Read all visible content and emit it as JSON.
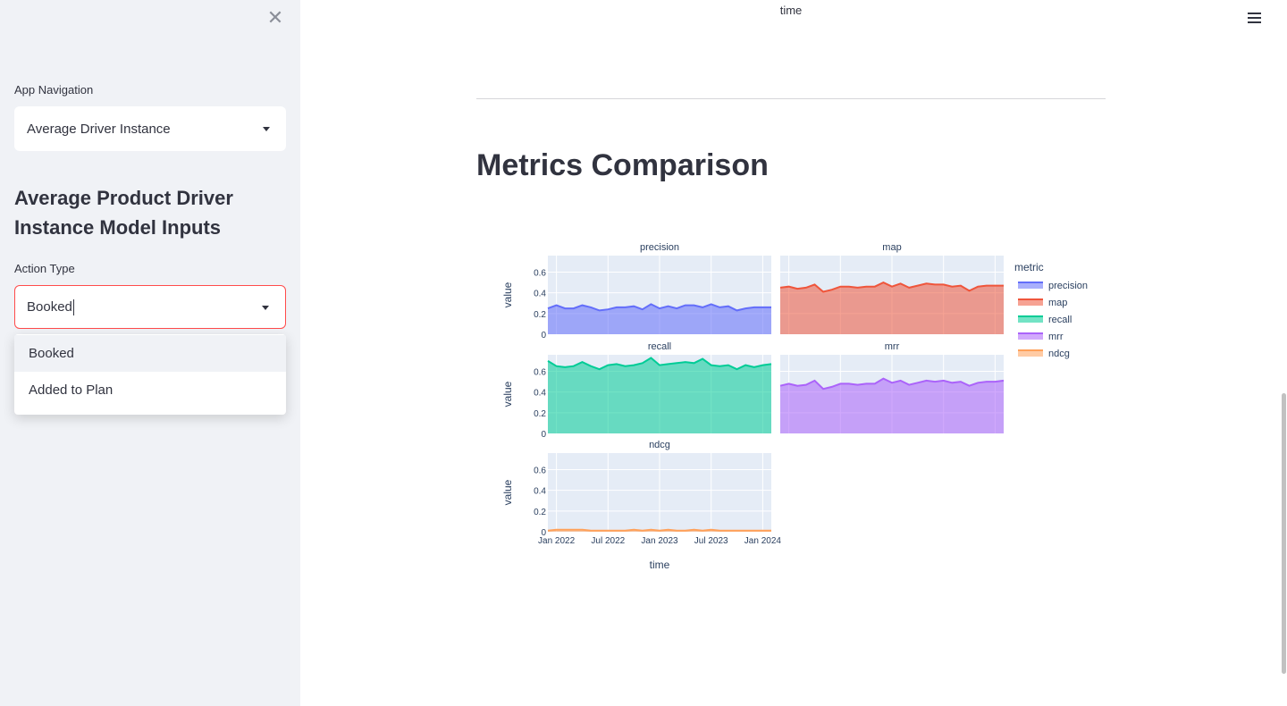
{
  "sidebar": {
    "nav_label": "App Navigation",
    "nav_value": "Average Driver Instance",
    "heading": "Average Product Driver Instance Model Inputs",
    "action_label": "Action Type",
    "action_value": "Booked",
    "dropdown_options": [
      "Booked",
      "Added to Plan"
    ]
  },
  "main": {
    "top_axis_label": "time",
    "title": "Metrics Comparison"
  },
  "colors": {
    "accent_red": "#ff4b4b",
    "precision": "#636efa",
    "map": "#ef553b",
    "recall": "#00cc96",
    "mrr": "#ab63fa",
    "ndcg": "#ffa15a"
  },
  "chart_data": {
    "type": "area",
    "facets": [
      "precision",
      "map",
      "recall",
      "mrr",
      "ndcg"
    ],
    "x": [
      "2021-12",
      "2022-01",
      "2022-02",
      "2022-03",
      "2022-04",
      "2022-05",
      "2022-06",
      "2022-07",
      "2022-08",
      "2022-09",
      "2022-10",
      "2022-11",
      "2022-12",
      "2023-01",
      "2023-02",
      "2023-03",
      "2023-04",
      "2023-05",
      "2023-06",
      "2023-07",
      "2023-08",
      "2023-09",
      "2023-10",
      "2023-11",
      "2023-12",
      "2024-01",
      "2024-02"
    ],
    "xticks": [
      "Jan 2022",
      "Jul 2022",
      "Jan 2023",
      "Jul 2023",
      "Jan 2024"
    ],
    "xlabel": "time",
    "ylabel": "value",
    "yticks": [
      "0",
      "0.2",
      "0.4",
      "0.6"
    ],
    "ylim": [
      0,
      0.76
    ],
    "legend_title": "metric",
    "legend_position": "right",
    "series": [
      {
        "name": "precision",
        "values": [
          0.25,
          0.28,
          0.25,
          0.25,
          0.28,
          0.26,
          0.23,
          0.24,
          0.26,
          0.26,
          0.27,
          0.24,
          0.29,
          0.25,
          0.27,
          0.25,
          0.28,
          0.28,
          0.26,
          0.29,
          0.26,
          0.27,
          0.23,
          0.25,
          0.26,
          0.26,
          0.26
        ]
      },
      {
        "name": "map",
        "values": [
          0.45,
          0.46,
          0.44,
          0.45,
          0.48,
          0.41,
          0.43,
          0.46,
          0.46,
          0.45,
          0.46,
          0.46,
          0.5,
          0.46,
          0.49,
          0.45,
          0.47,
          0.49,
          0.48,
          0.48,
          0.46,
          0.47,
          0.42,
          0.46,
          0.47,
          0.47,
          0.47
        ]
      },
      {
        "name": "recall",
        "values": [
          0.7,
          0.65,
          0.64,
          0.65,
          0.69,
          0.65,
          0.62,
          0.66,
          0.67,
          0.65,
          0.66,
          0.68,
          0.73,
          0.66,
          0.67,
          0.68,
          0.69,
          0.68,
          0.72,
          0.66,
          0.65,
          0.66,
          0.62,
          0.66,
          0.64,
          0.66,
          0.67
        ]
      },
      {
        "name": "mrr",
        "values": [
          0.46,
          0.48,
          0.46,
          0.47,
          0.51,
          0.43,
          0.45,
          0.48,
          0.48,
          0.47,
          0.48,
          0.48,
          0.53,
          0.49,
          0.51,
          0.47,
          0.49,
          0.51,
          0.5,
          0.51,
          0.49,
          0.5,
          0.46,
          0.49,
          0.5,
          0.5,
          0.51
        ]
      },
      {
        "name": "ndcg",
        "values": [
          0.01,
          0.02,
          0.02,
          0.02,
          0.02,
          0.01,
          0.01,
          0.01,
          0.01,
          0.01,
          0.02,
          0.01,
          0.02,
          0.01,
          0.02,
          0.01,
          0.01,
          0.02,
          0.01,
          0.02,
          0.01,
          0.01,
          0.01,
          0.01,
          0.01,
          0.01,
          0.01
        ]
      }
    ]
  }
}
